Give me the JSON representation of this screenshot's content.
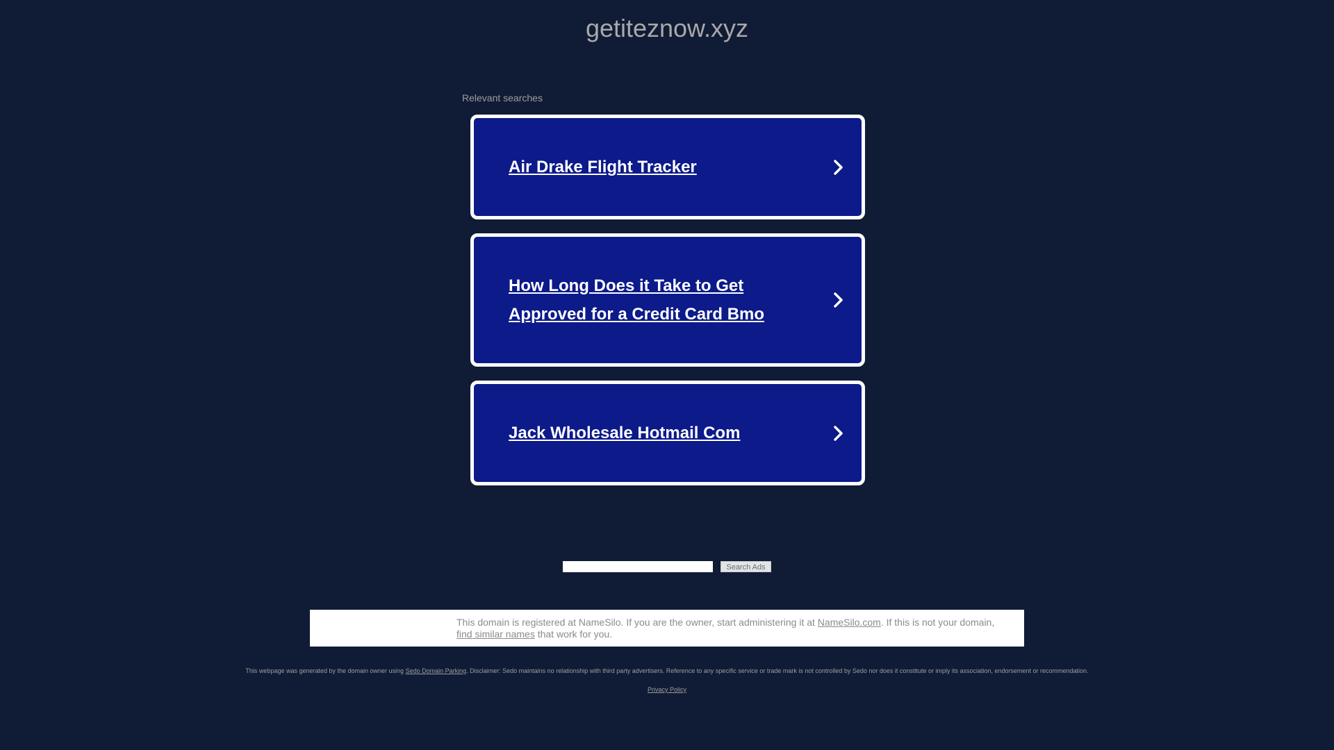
{
  "header": {
    "domain": "getiteznow.xyz"
  },
  "relevant": {
    "label": "Relevant searches",
    "links": [
      {
        "text": "Air Drake Flight Tracker"
      },
      {
        "text": "How Long Does it Take to Get Approved for a Credit Card Bmo"
      },
      {
        "text": "Jack Wholesale Hotmail Com"
      }
    ]
  },
  "search": {
    "input_value": "",
    "button_label": "Search Ads"
  },
  "notice": {
    "part1": "This domain is registered at NameSilo. If you are the owner, start administering it at ",
    "link1": "NameSilo.com",
    "part2": ". If this is not your domain, ",
    "link2": "find similar names",
    "part3": " that work for you."
  },
  "footer": {
    "disclaimer_pre": "This webpage was generated by the domain owner using ",
    "disclaimer_link": "Sedo Domain Parking",
    "disclaimer_post": ". Disclaimer: Sedo maintains no relationship with third party advertisers. Reference to any specific service or trade mark is not controlled by Sedo nor does it constitute or imply its association, endorsement or recommendation.",
    "privacy": "Privacy Policy"
  },
  "icons": {
    "card_arrow": "chevron-right-icon"
  },
  "colors": {
    "background": "#101c36",
    "card": "#0c1a8a",
    "card_border": "#ffffff"
  }
}
